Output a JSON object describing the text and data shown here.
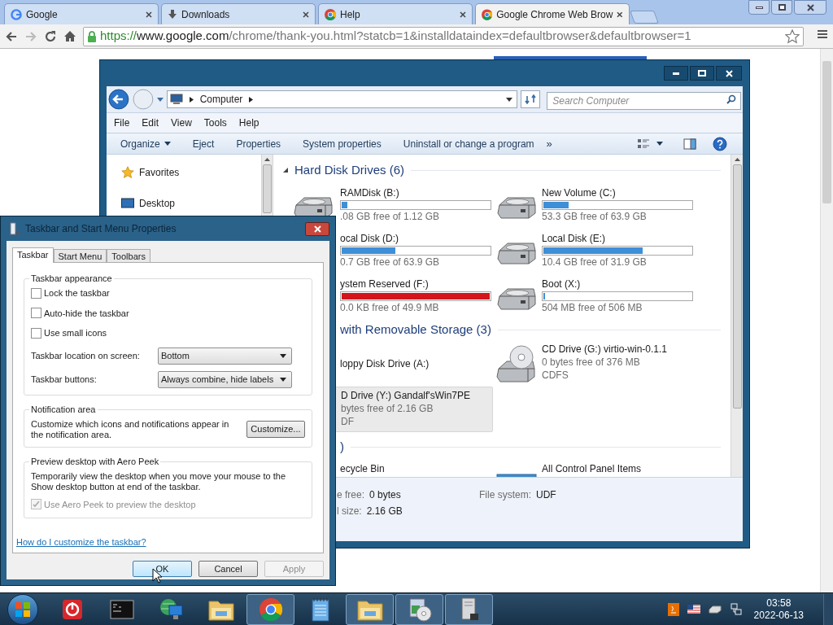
{
  "browser": {
    "tabs": [
      {
        "title": "Google",
        "selected": false
      },
      {
        "title": "Downloads",
        "selected": false
      },
      {
        "title": "Help",
        "selected": false
      },
      {
        "title": "Google Chrome Web Brow",
        "selected": true
      }
    ],
    "url": [
      {
        "text": "https://",
        "kind": "scheme"
      },
      {
        "text": "www.google.com",
        "kind": "host"
      },
      {
        "text": "/chrome/thank-you.html?statcb=1&installdataindex=defaultbrowser&defaultbrowser=1",
        "kind": "path"
      }
    ]
  },
  "explorer": {
    "breadcrumb": "Computer",
    "search_placeholder": "Search Computer",
    "menu": [
      "File",
      "Edit",
      "View",
      "Tools",
      "Help"
    ],
    "commands": [
      {
        "label": "Organize",
        "dropdown": true
      },
      {
        "label": "Eject",
        "dropdown": false
      },
      {
        "label": "Properties",
        "dropdown": false
      },
      {
        "label": "System properties",
        "dropdown": false
      },
      {
        "label": "Uninstall or change a program",
        "dropdown": false
      }
    ],
    "overflow": "»",
    "sidebar": [
      {
        "label": "Favorites",
        "kind": "favorites"
      },
      {
        "label": "Desktop",
        "kind": "desktop"
      }
    ],
    "groups": [
      {
        "title": "Hard Disk Drives (6)",
        "expanded": true,
        "items": [
          {
            "kind": "drive",
            "selected": false,
            "name": "RAMDisk (B:)",
            "free": ".08 GB free of 1.12 GB",
            "level": 0.04,
            "warning": false
          },
          {
            "kind": "drive",
            "selected": false,
            "name": "New Volume (C:)",
            "free": "53.3 GB free of 63.9 GB",
            "level": 0.17,
            "warning": false
          },
          {
            "kind": "drive",
            "selected": false,
            "name": "ocal Disk (D:)",
            "free": "0.7 GB free of 63.9 GB",
            "level": 0.36,
            "warning": false
          },
          {
            "kind": "drive",
            "selected": false,
            "name": "Local Disk (E:)",
            "free": "10.4 GB free of 31.9 GB",
            "level": 0.67,
            "warning": false
          },
          {
            "kind": "drive",
            "selected": false,
            "name": "ystem Reserved (F:)",
            "free": "0.0 KB free of 49.9 MB",
            "level": 1,
            "warning": true
          },
          {
            "kind": "drive",
            "selected": false,
            "name": "Boot (X:)",
            "free": "504 MB free of 506 MB",
            "level": 0.01,
            "warning": false
          }
        ]
      },
      {
        "title": "with Removable Storage (3)",
        "items": [
          {
            "kind": "plain",
            "selected": false,
            "name": "loppy Disk Drive (A:)"
          },
          {
            "kind": "cd",
            "selected": false,
            "name": "CD Drive (G:) virtio-win-0.1.1",
            "free": "0 bytes free of 376 MB",
            "fs": "CDFS"
          },
          {
            "kind": "cd",
            "selected": true,
            "name": "D Drive (Y:) Gandalf'sWin7PE",
            "free": "bytes free of 2.16 GB",
            "fs": "DF"
          }
        ]
      },
      {
        "title": ")",
        "items": [
          {
            "kind": "system",
            "selected": false,
            "name": "ecycle Bin"
          },
          {
            "kind": "panel",
            "selected": false,
            "name": "All Control Panel Items"
          }
        ]
      }
    ],
    "details": [
      {
        "label": "e free:",
        "value": "0 bytes"
      },
      {
        "label": "l size:",
        "value": "2.16 GB"
      },
      {
        "label": "File system:",
        "value": "UDF"
      }
    ]
  },
  "dialog": {
    "title": "Taskbar and Start Menu Properties",
    "tabs": [
      {
        "label": "Taskbar",
        "selected": true
      },
      {
        "label": "Start Menu",
        "selected": false
      },
      {
        "label": "Toolbars",
        "selected": false
      }
    ],
    "appearance": {
      "title": "Taskbar appearance",
      "checkboxes": [
        {
          "label": "Lock the taskbar",
          "checked": false
        },
        {
          "label": "Auto-hide the taskbar",
          "checked": false
        },
        {
          "label": "Use small icons",
          "checked": false
        }
      ],
      "selects": [
        {
          "label": "Taskbar location on screen:",
          "value": "Bottom"
        },
        {
          "label": "Taskbar buttons:",
          "value": "Always combine, hide labels"
        }
      ]
    },
    "notification": {
      "title": "Notification area",
      "text": "Customize which icons and notifications appear in the notification area.",
      "button": "Customize..."
    },
    "peek": {
      "title": "Preview desktop with Aero Peek",
      "text": "Temporarily view the desktop when you move your mouse to the Show desktop button at end of the taskbar.",
      "checkbox": {
        "label": "Use Aero Peek to preview the desktop",
        "checked": true,
        "disabled": true
      }
    },
    "link": "How do I customize the taskbar?",
    "buttons": [
      {
        "label": "OK",
        "kind": "default",
        "disabled": false
      },
      {
        "label": "Cancel",
        "kind": "normal",
        "disabled": false
      },
      {
        "label": "Apply",
        "kind": "normal",
        "disabled": true
      }
    ]
  },
  "taskbar": {
    "buttons": [
      {
        "kind": "power",
        "running": false
      },
      {
        "kind": "terminal",
        "running": false
      },
      {
        "kind": "network",
        "running": false
      },
      {
        "kind": "folder",
        "running": false
      },
      {
        "kind": "chrome",
        "running": true
      },
      {
        "kind": "notepad",
        "running": false
      },
      {
        "kind": "folder",
        "running": true
      },
      {
        "kind": "installer",
        "running": true
      },
      {
        "kind": "server",
        "running": true
      }
    ],
    "time": "03:58",
    "date": "2022-06-13"
  }
}
